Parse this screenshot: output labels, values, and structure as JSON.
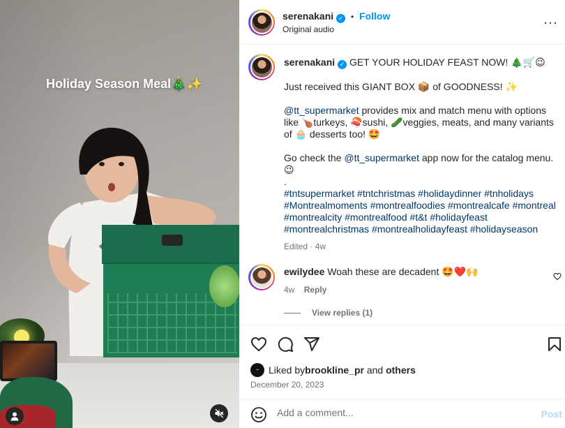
{
  "video": {
    "overlay_title": "Holiday Season Meal🎄✨",
    "user_icon": "person-icon",
    "mute_icon": "speaker-muted-icon"
  },
  "header": {
    "username": "serenakani",
    "dot": "•",
    "follow_label": "Follow",
    "audio_label": "Original audio",
    "more_icon": "more-options-icon"
  },
  "caption": {
    "username": "serenakani",
    "line1": "GET YOUR HOLIDAY FEAST NOW! 🎄🛒😉",
    "line2": "Just received this GIANT BOX 📦 of GOODNESS! ✨",
    "mention1": "@tt_supermarket",
    "line3": " provides mix and match menu with options like 🍗turkeys, 🍣sushi, 🥒veggies, meats, and many variants of 🧁 desserts too! 🤩",
    "line4_pre": "Go check the ",
    "mention2": "@tt_supermarket",
    "line4_post": " app now for the catalog menu. 😉",
    "dot": ".",
    "hashtags": "#tntsupermarket #tntchristmas #holidaydinner #tnholidays #Montrealmoments #montrealfoodies #montrealcafe #montreal #montrealcity #montrealfood #t&t #holidayfeast #montrealchristmas #montrealholidayfeast #holidayseason",
    "meta": "Edited · 4w"
  },
  "comment": {
    "username": "ewilydee",
    "text": "Woah these are decadent 🤩❤️🙌",
    "age": "4w",
    "reply_label": "Reply",
    "view_replies": "View replies (1)"
  },
  "actions": {
    "like_icon": "heart-icon",
    "comment_icon": "comment-icon",
    "share_icon": "send-icon",
    "save_icon": "bookmark-icon"
  },
  "likes": {
    "prefix": "Liked by ",
    "user": "brookline_pr",
    "middle": " and ",
    "others": "others"
  },
  "date": "December 20, 2023",
  "add_comment": {
    "placeholder": "Add a comment...",
    "post_label": "Post",
    "emoji_icon": "smiley-icon"
  },
  "colors": {
    "accent": "#0095f6",
    "link": "#00376b",
    "muted": "#737373",
    "box_green": "#1f7d55"
  }
}
